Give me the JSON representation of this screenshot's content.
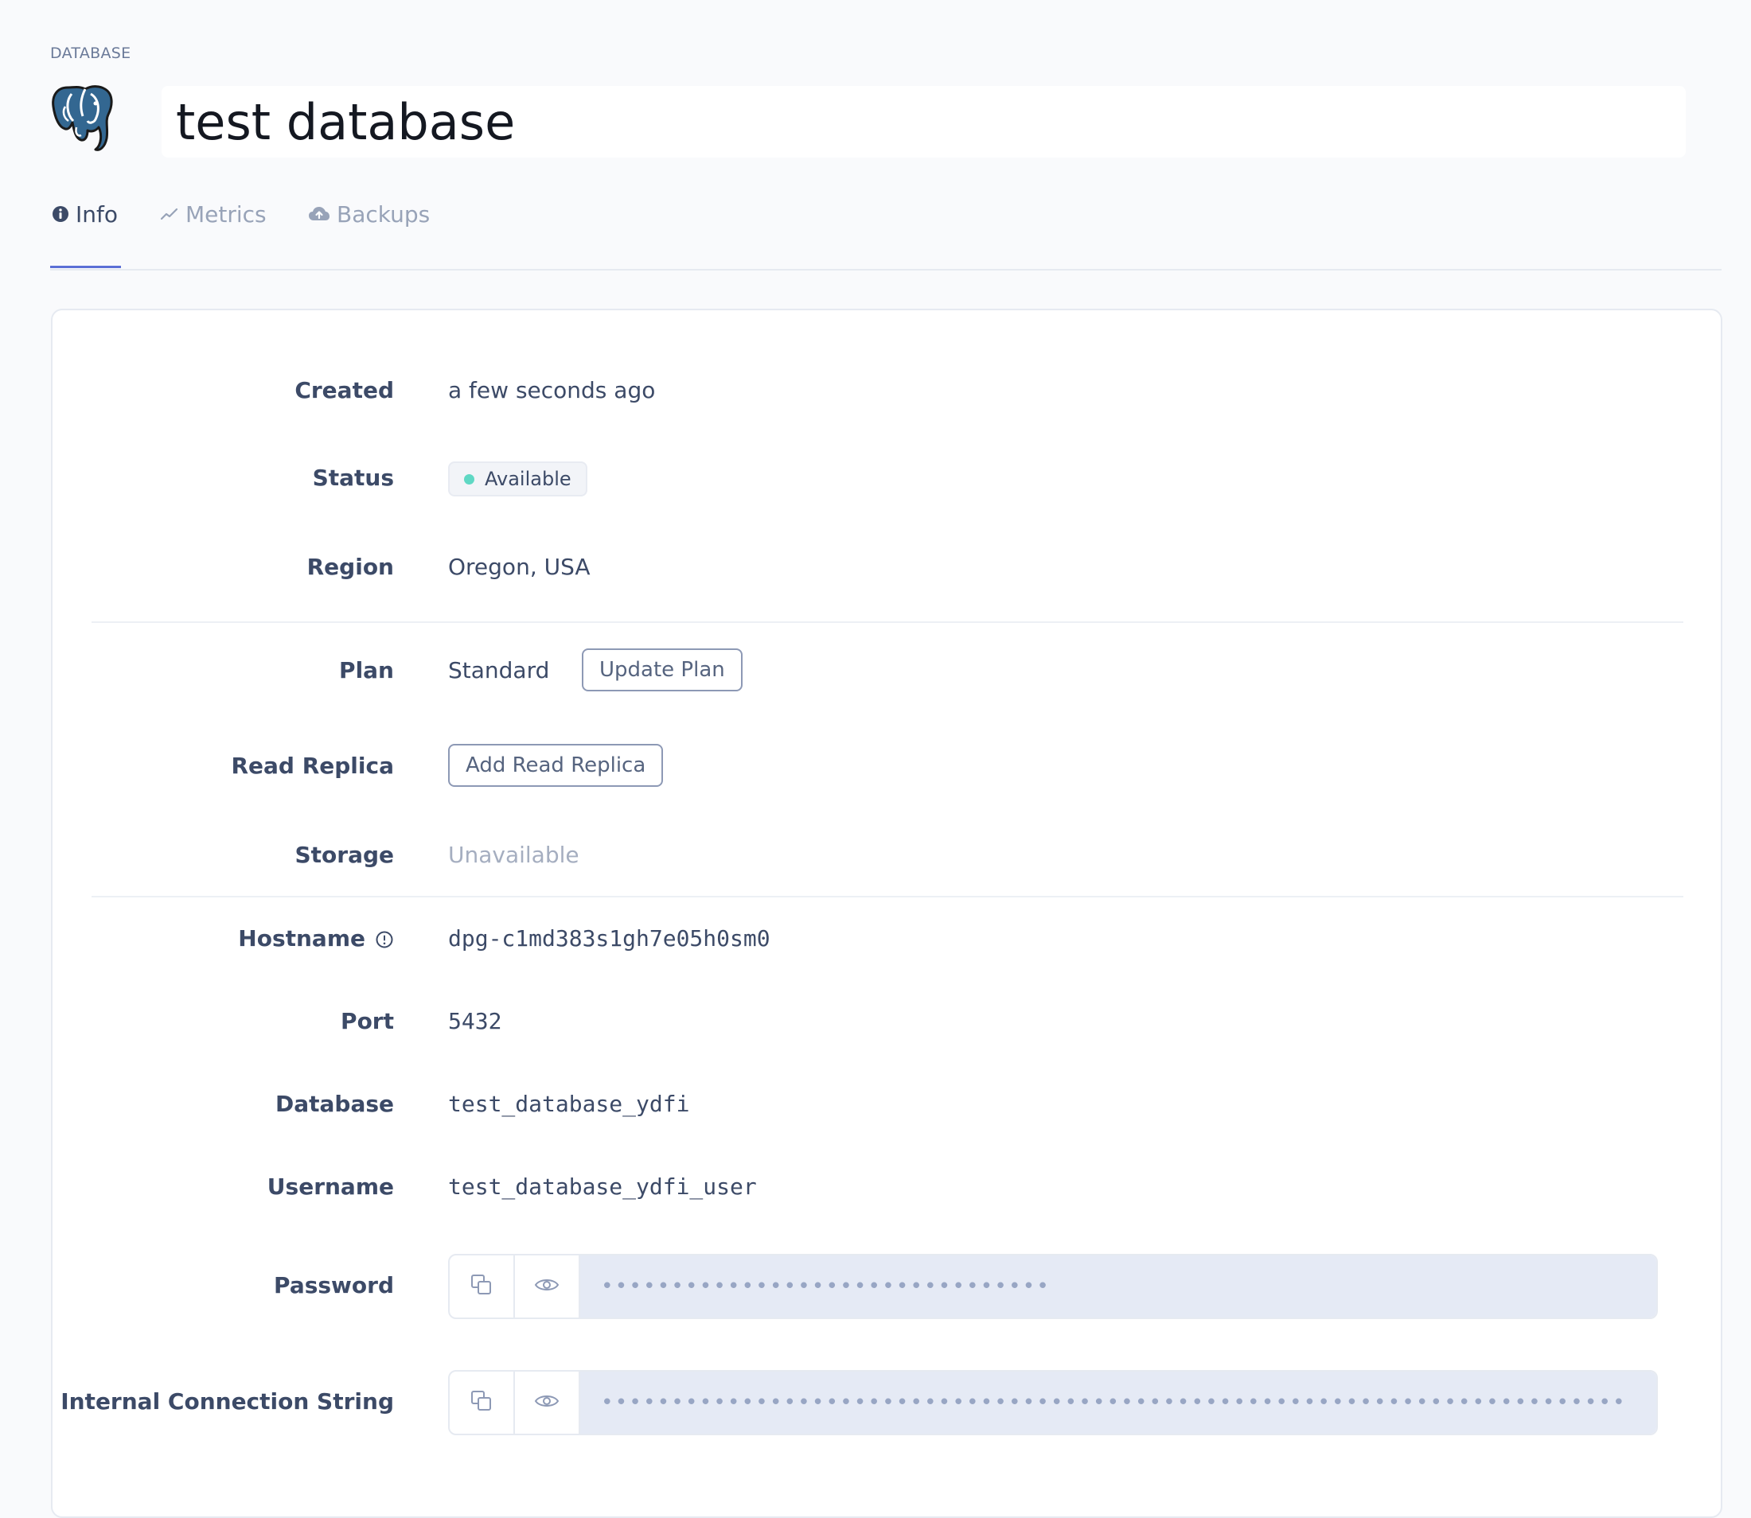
{
  "header": {
    "eyebrow": "DATABASE",
    "title": "test database",
    "logo_icon": "postgresql-elephant-icon"
  },
  "tabs": [
    {
      "label": "Info",
      "icon": "info-circle-icon",
      "active": true
    },
    {
      "label": "Metrics",
      "icon": "trend-line-icon",
      "active": false
    },
    {
      "label": "Backups",
      "icon": "cloud-upload-icon",
      "active": false
    }
  ],
  "info": {
    "created": {
      "label": "Created",
      "value": "a few seconds ago"
    },
    "status": {
      "label": "Status",
      "value": "Available",
      "dot_color": "#5fd8c4"
    },
    "region": {
      "label": "Region",
      "value": "Oregon, USA"
    },
    "plan": {
      "label": "Plan",
      "value": "Standard",
      "button": "Update Plan"
    },
    "read_replica": {
      "label": "Read Replica",
      "button": "Add Read Replica"
    },
    "storage": {
      "label": "Storage",
      "value": "Unavailable"
    },
    "hostname": {
      "label": "Hostname",
      "value": "dpg-c1md383s1gh7e05h0sm0"
    },
    "port": {
      "label": "Port",
      "value": "5432"
    },
    "database": {
      "label": "Database",
      "value": "test_database_ydfi"
    },
    "username": {
      "label": "Username",
      "value": "test_database_ydfi_user"
    },
    "password": {
      "label": "Password",
      "masked": "••••••••••••••••••••••••••••••••"
    },
    "internal_connection_string": {
      "label": "Internal Connection String",
      "masked": "•••••••••••••••••••••••••••••••••••••••••••••••••••••••••••••••••••••••••"
    }
  },
  "colors": {
    "accent": "#5b6fd6",
    "text": "#3c4a67",
    "muted": "#a5aec0",
    "masked_field_bg": "#e5eaf5"
  }
}
